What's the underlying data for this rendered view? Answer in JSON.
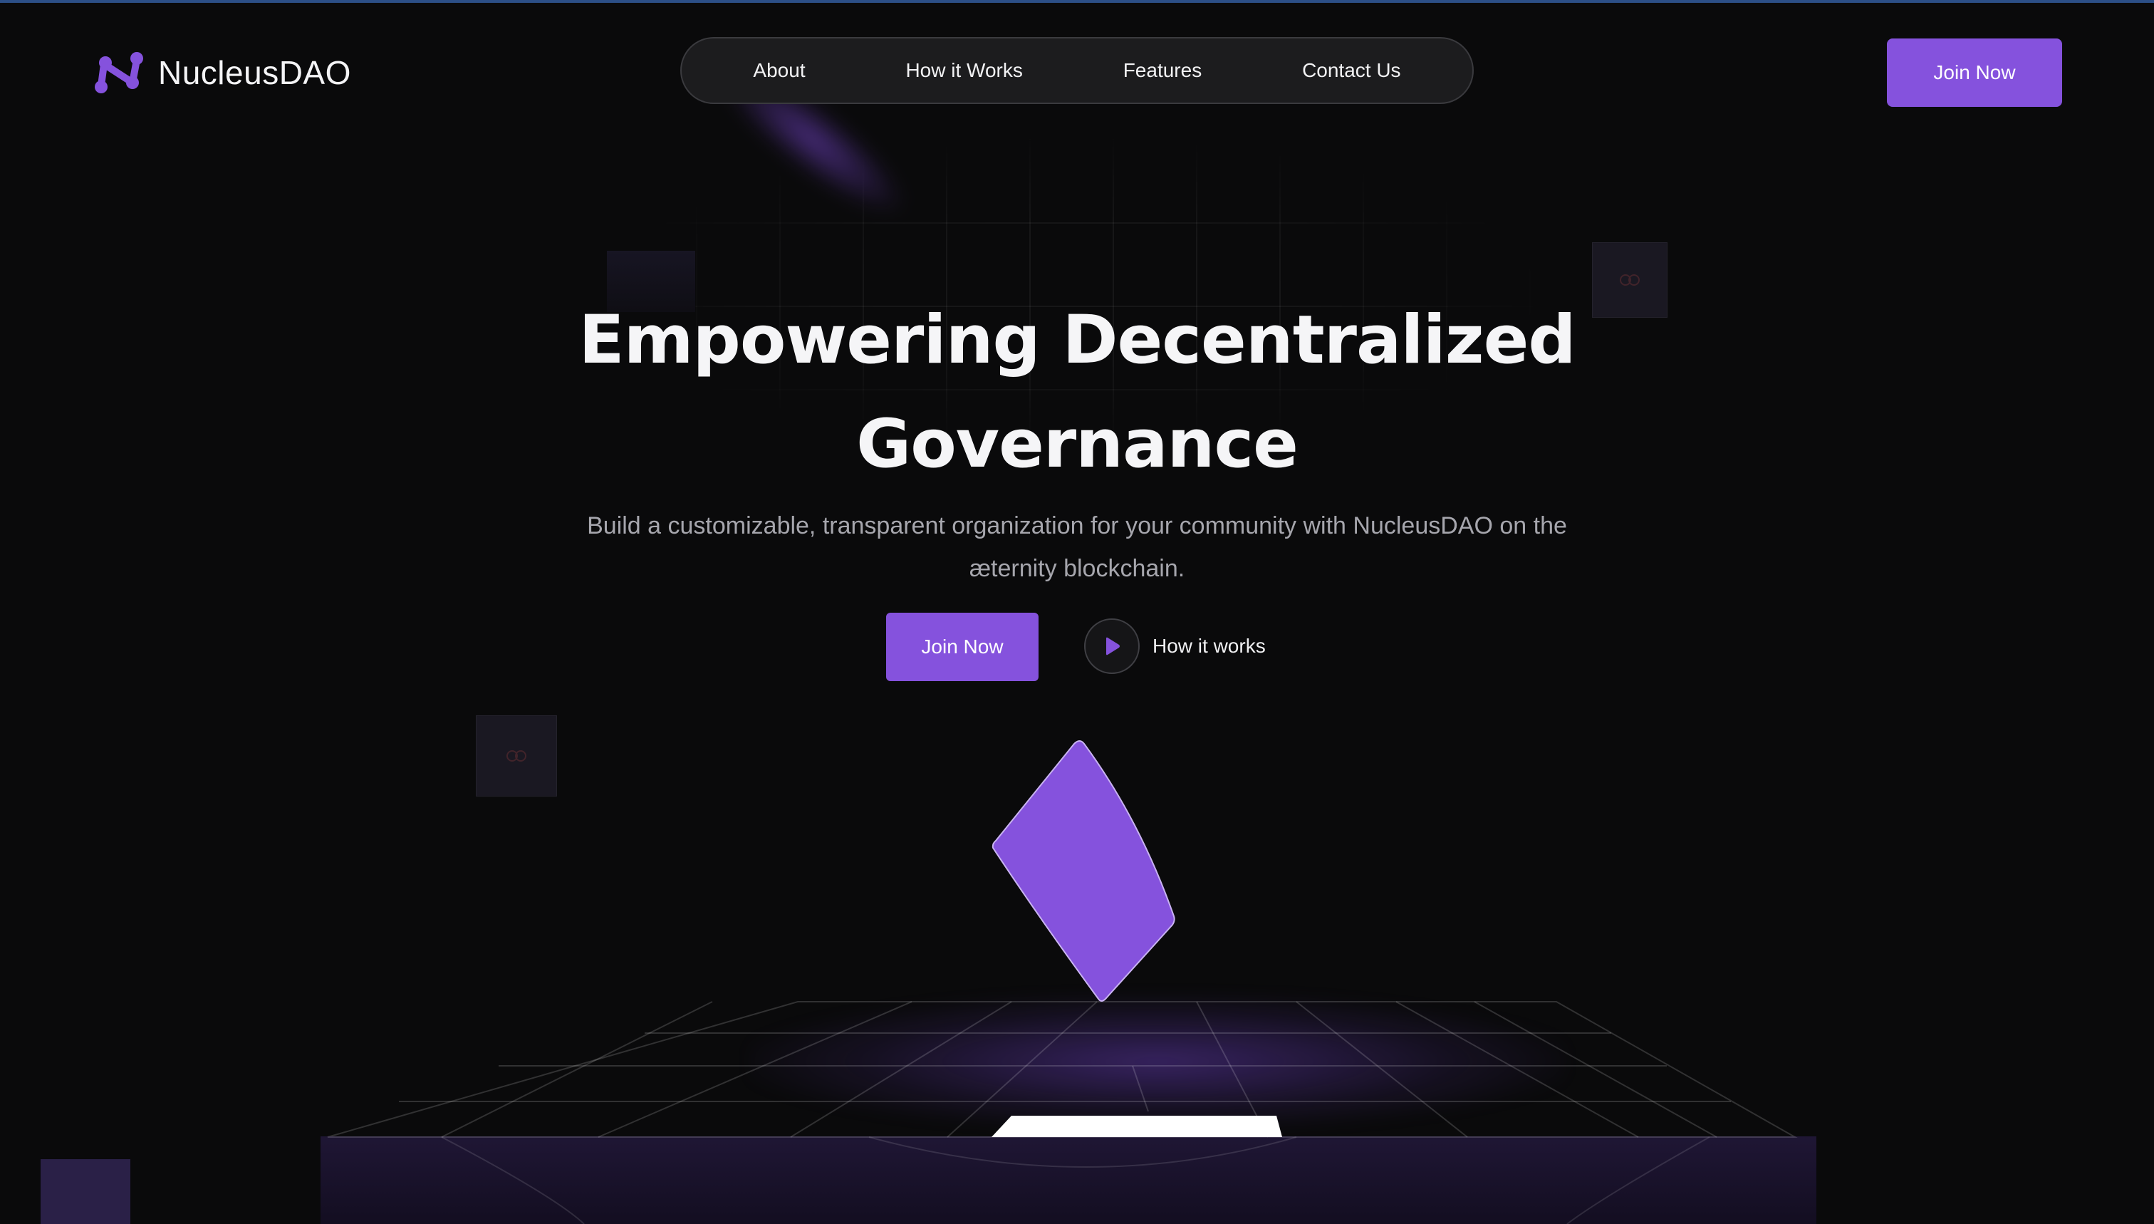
{
  "brand": {
    "name": "NucleusDAO",
    "logo_icon": "nucleus-n-logo-icon",
    "accent_color": "#8552DD"
  },
  "nav": {
    "links": [
      {
        "label": "About"
      },
      {
        "label": "How it Works"
      },
      {
        "label": "Features"
      },
      {
        "label": "Contact Us"
      }
    ],
    "cta_label": "Join Now"
  },
  "hero": {
    "title_line1": "Empowering Decentralized",
    "title_line2": "Governance",
    "subtitle_line1": "Build a customizable, transparent organization for your community with NucleusDAO on the",
    "subtitle_line2": "æternity blockchain.",
    "primary_cta": "Join Now",
    "secondary_cta": "How it works",
    "secondary_icon": "play-icon"
  },
  "scene": {
    "illustration": "ballot-card-over-grid-platform",
    "card_color": "#8552DD"
  }
}
